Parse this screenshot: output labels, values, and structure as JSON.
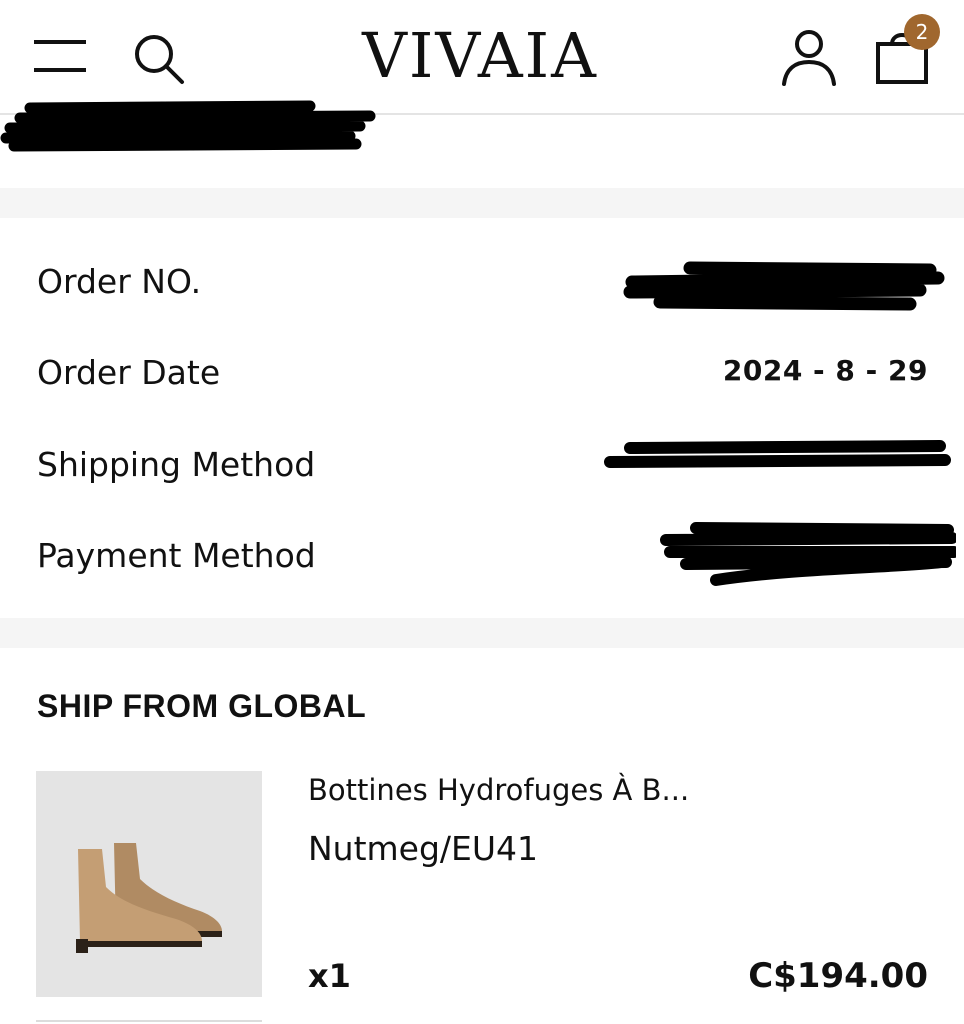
{
  "header": {
    "logo": "VIVAIA",
    "cart_count": "2",
    "icons": [
      "menu-icon",
      "search-icon",
      "account-icon",
      "shopping-bag-icon"
    ]
  },
  "order_info": {
    "rows": [
      {
        "label": "Order NO.",
        "value": ""
      },
      {
        "label": "Order Date",
        "value": "2024 - 8 - 29"
      },
      {
        "label": "Shipping Method",
        "value": ""
      },
      {
        "label": "Payment Method",
        "value": ""
      }
    ]
  },
  "shipment": {
    "title": "SHIP FROM GLOBAL",
    "item": {
      "name": "Bottines Hydrofuges À B...",
      "variant": "Nutmeg/EU41",
      "quantity": "x1",
      "price": "C$194.00"
    }
  },
  "colors": {
    "badge": "#a0672e",
    "band": "#f5f5f5",
    "image_bg": "#e4e4e4",
    "text": "#111111"
  }
}
